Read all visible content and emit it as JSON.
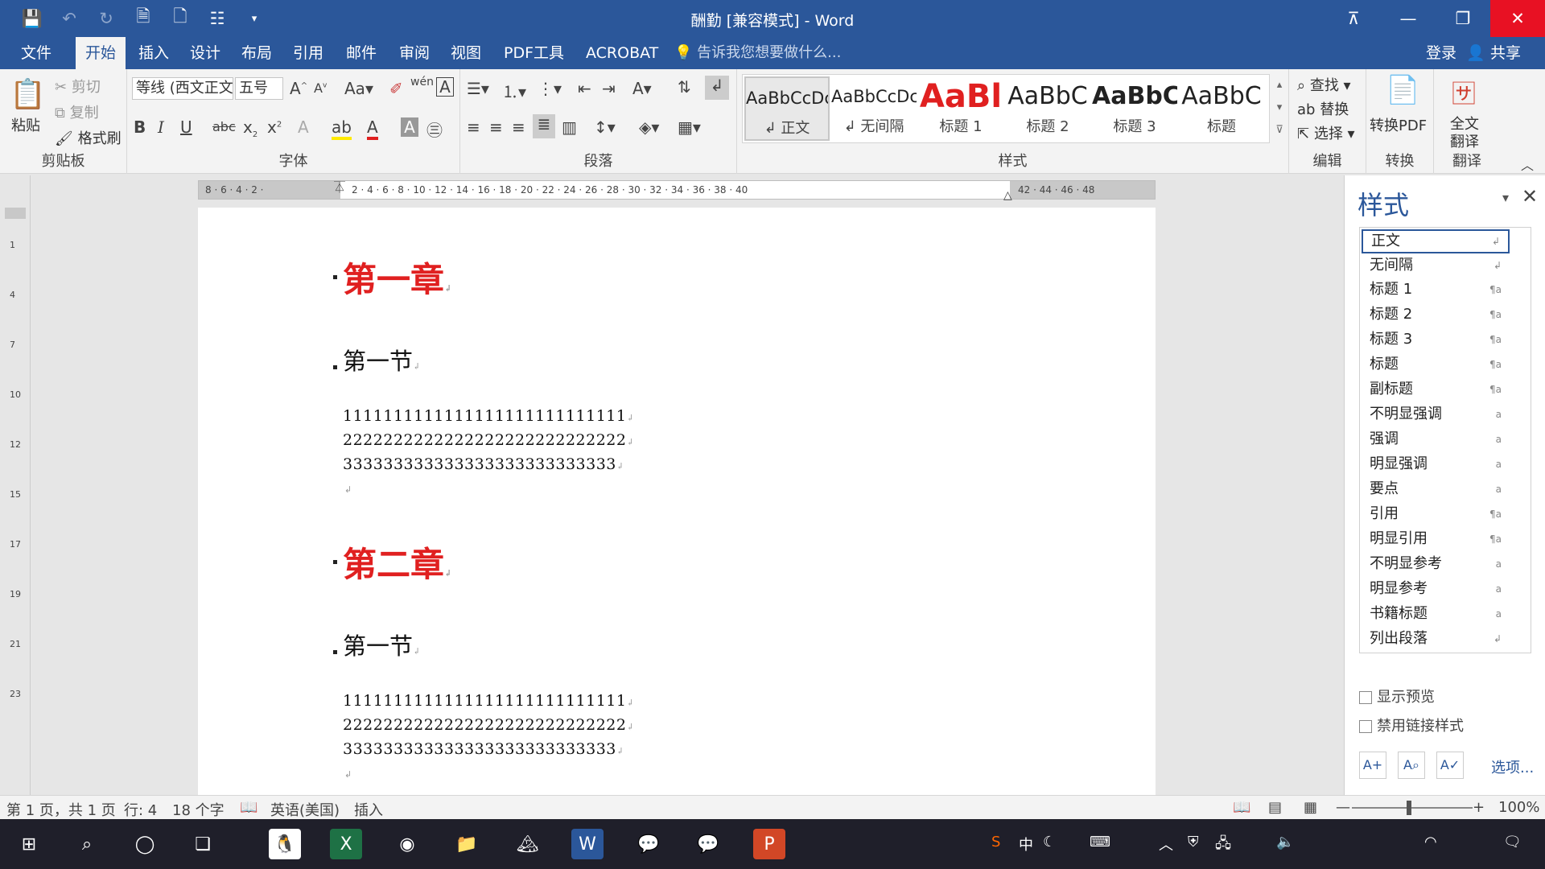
{
  "window": {
    "title": "酬勤 [兼容模式] - Word"
  },
  "qat": {
    "icons": [
      "save-icon",
      "undo-icon",
      "redo-icon",
      "save-as-icon",
      "new-doc-icon",
      "touch-mode-icon",
      "customize-icon"
    ]
  },
  "tabs": [
    "文件",
    "开始",
    "插入",
    "设计",
    "布局",
    "引用",
    "邮件",
    "审阅",
    "视图",
    "PDF工具",
    "ACROBAT"
  ],
  "tell_me": "告诉我您想要做什么...",
  "account": {
    "signin": "登录",
    "share": "共享"
  },
  "clipboard": {
    "paste": "粘贴",
    "cut": "剪切",
    "copy": "复制",
    "format_painter": "格式刷",
    "group": "剪贴板"
  },
  "font": {
    "family": "等线 (西文正文",
    "size": "五号",
    "group": "字体"
  },
  "paragraph": {
    "group": "段落"
  },
  "styles_gallery": {
    "group": "样式",
    "items": [
      {
        "preview": "AaBbCcDc",
        "name": "正文"
      },
      {
        "preview": "AaBbCcDc",
        "name": "无间隔"
      },
      {
        "preview": "AaBl",
        "name": "标题 1"
      },
      {
        "preview": "AaBbC",
        "name": "标题 2"
      },
      {
        "preview": "AaBbC",
        "name": "标题 3"
      },
      {
        "preview": "AaBbC",
        "name": "标题"
      }
    ]
  },
  "editing": {
    "find": "查找",
    "replace": "替换",
    "select": "选择",
    "group": "编辑"
  },
  "convert": {
    "to_pdf": "转换PDF",
    "group": "转换"
  },
  "translate": {
    "full": "全文",
    "translate": "翻译",
    "group": "翻译"
  },
  "document": {
    "h1_a": "第一章",
    "h2_a": "第一节",
    "line1": "1111111111111111111111111111",
    "line2": "2222222222222222222222222222",
    "line3": "333333333333333333333333333",
    "h1_b": "第二章",
    "h2_b": "第一节"
  },
  "styles_pane": {
    "title": "样式",
    "items": [
      "正文",
      "无间隔",
      "标题 1",
      "标题 2",
      "标题 3",
      "标题",
      "副标题",
      "不明显强调",
      "强调",
      "明显强调",
      "要点",
      "引用",
      "明显引用",
      "不明显参考",
      "明显参考",
      "书籍标题",
      "列出段落"
    ],
    "show_preview": "显示预览",
    "disable_linked": "禁用链接样式",
    "options": "选项..."
  },
  "status": {
    "page": "第 1 页，共 1 页",
    "line": "行: 4",
    "words": "18 个字",
    "language": "英语(美国)",
    "mode": "插入",
    "zoom": "100%"
  },
  "tray": {
    "ime": "中"
  }
}
